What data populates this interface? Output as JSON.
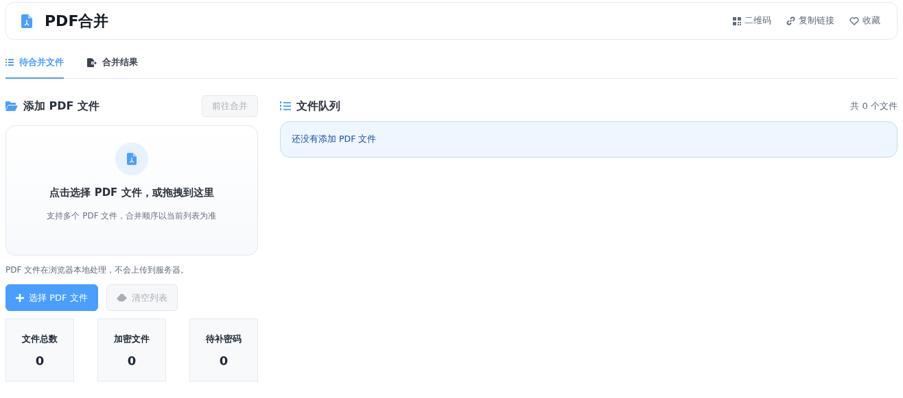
{
  "header": {
    "title": "PDF合并",
    "actions": [
      {
        "kind": "qrcode",
        "label": "二维码"
      },
      {
        "kind": "link",
        "label": "复制链接"
      },
      {
        "kind": "favorite",
        "label": "收藏"
      }
    ]
  },
  "tabs": [
    {
      "kind": "list",
      "label": "待合并文件",
      "selected": true
    },
    {
      "kind": "result",
      "label": "合并结果",
      "selected": false
    }
  ],
  "add_panel": {
    "title": "添加 PDF 文件",
    "go_button": {
      "label": "前往合并",
      "disabled": true
    },
    "dropzone": {
      "title": "点击选择 PDF 文件，或拖拽到这里",
      "hint": "支持多个 PDF 文件，合并顺序以当前列表为准"
    },
    "note": "PDF 文件在浏览器本地处理，不会上传到服务器。",
    "select_button": {
      "label": "选择 PDF 文件",
      "disabled": false
    },
    "clear_button": {
      "label": "清空列表",
      "disabled": true
    },
    "stats": [
      {
        "label": "文件总数",
        "value": "0"
      },
      {
        "label": "加密文件",
        "value": "0"
      },
      {
        "label": "待补密码",
        "value": "0"
      }
    ]
  },
  "queue": {
    "title": "文件队列",
    "count": "共 0 个文件",
    "empty_message": "还没有添加 PDF 文件"
  }
}
